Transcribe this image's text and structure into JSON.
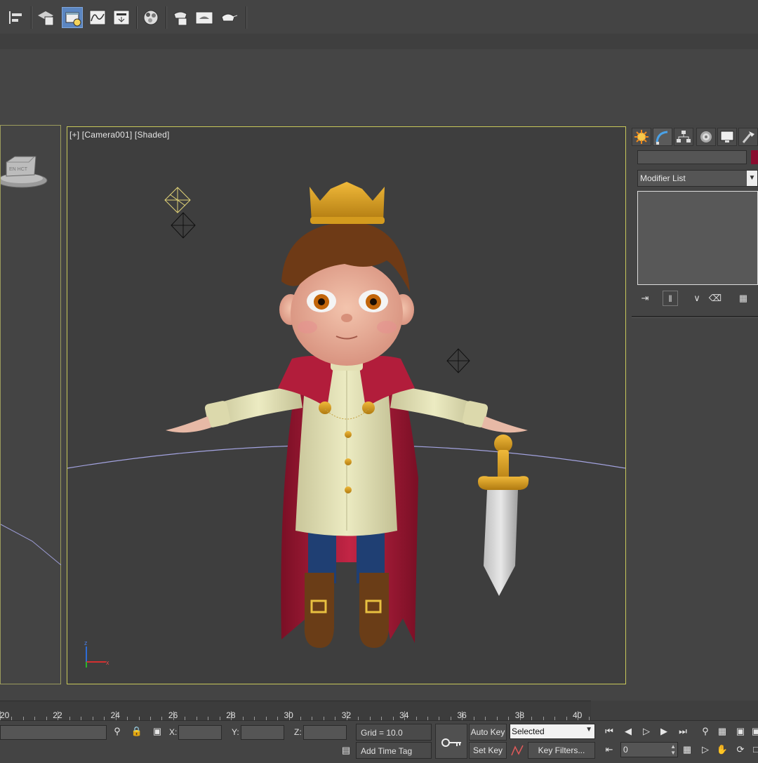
{
  "viewport": {
    "label": "[+] [Camera001] [Shaded]"
  },
  "command_panel": {
    "modifier_list_label": "Modifier List",
    "object_color": "#8a0c2f"
  },
  "timeline": {
    "ticks": [
      "20",
      "22",
      "24",
      "26",
      "28",
      "30",
      "32",
      "34",
      "36",
      "38",
      "40"
    ]
  },
  "status": {
    "x_label": "X:",
    "y_label": "Y:",
    "z_label": "Z:",
    "grid_text": "Grid = 10.0",
    "add_time_tag": "Add Time Tag",
    "auto_key": "Auto Key",
    "set_key": "Set Key",
    "key_mode": "Selected",
    "key_filters": "Key Filters...",
    "frame_value": "0"
  },
  "colors": {
    "viewport_border_active": "#c8c85a",
    "viewport_bg": "#3e3e3e",
    "toolbar_active": "#5b86c1"
  },
  "icons": {
    "toolbar": [
      "align-icon",
      "layer-manager-icon",
      "scene-explorer-icon",
      "curve-editor-icon",
      "schematic-view-icon",
      "material-editor-icon",
      "render-setup-icon",
      "rendered-frame-window-icon",
      "render-production-icon"
    ],
    "command_tabs": [
      "create-tab-icon",
      "modify-tab-icon",
      "hierarchy-tab-icon",
      "motion-tab-icon",
      "display-tab-icon",
      "utilities-tab-icon"
    ]
  }
}
